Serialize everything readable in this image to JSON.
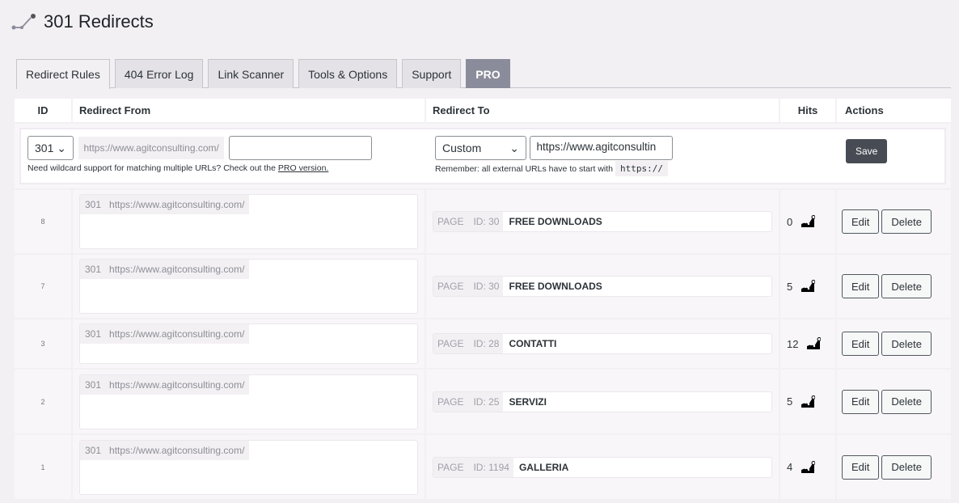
{
  "header": {
    "title": "301 Redirects",
    "icon": "redirect-chart-icon"
  },
  "tabs": [
    {
      "label": "Redirect Rules",
      "active": true
    },
    {
      "label": "404 Error Log"
    },
    {
      "label": "Link Scanner"
    },
    {
      "label": "Tools & Options"
    },
    {
      "label": "Support"
    },
    {
      "label": "PRO"
    }
  ],
  "table": {
    "columns": {
      "id": "ID",
      "from": "Redirect From",
      "to": "Redirect To",
      "hits": "Hits",
      "actions": "Actions"
    },
    "add_form": {
      "status_code": "301",
      "from_prefix": "https://www.agitconsulting.com/",
      "from_value": "",
      "from_hint": "Need wildcard support for matching multiple URLs? Check out the ",
      "from_hint_link": "PRO version.",
      "to_type": "Custom",
      "to_value": "https://www.agitconsultin",
      "to_hint": "Remember: all external URLs have to start with",
      "to_hint_code": "https://",
      "save_label": "Save"
    },
    "rows": [
      {
        "id": "8",
        "code": "301",
        "from_prefix": "https://www.agitconsulting.com/",
        "type": "PAGE",
        "page_id": "ID: 30",
        "target": "FREE DOWNLOADS",
        "hits": "0"
      },
      {
        "id": "7",
        "code": "301",
        "from_prefix": "https://www.agitconsulting.com/",
        "type": "PAGE",
        "page_id": "ID: 30",
        "target": "FREE DOWNLOADS",
        "hits": "5"
      },
      {
        "id": "3",
        "code": "301",
        "from_prefix": "https://www.agitconsulting.com/",
        "type": "PAGE",
        "page_id": "ID: 28",
        "target": "CONTATTI",
        "hits": "12"
      },
      {
        "id": "2",
        "code": "301",
        "from_prefix": "https://www.agitconsulting.com/",
        "type": "PAGE",
        "page_id": "ID: 25",
        "target": "SERVIZI",
        "hits": "5"
      },
      {
        "id": "1",
        "code": "301",
        "from_prefix": "https://www.agitconsulting.com/",
        "type": "PAGE",
        "page_id": "ID: 1194",
        "target": "GALLERIA",
        "hits": "4"
      }
    ],
    "edit_label": "Edit",
    "delete_label": "Delete"
  }
}
